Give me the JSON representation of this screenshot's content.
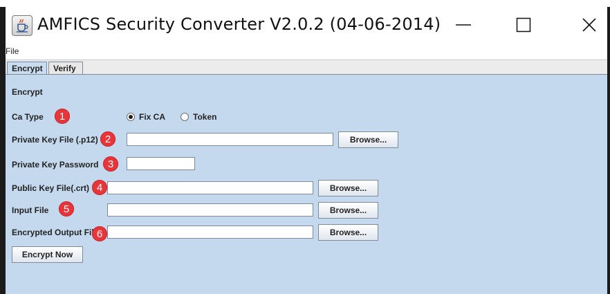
{
  "window": {
    "title": "AMFICS Security Converter V2.0.2 (04-06-2014)",
    "icon": "java-cup-icon"
  },
  "menu": {
    "file_label": "File"
  },
  "tabs": [
    {
      "label": "Encrypt",
      "active": true
    },
    {
      "label": "Verify",
      "active": false
    }
  ],
  "panel": {
    "section_label": "Encrypt",
    "ca_type": {
      "label": "Ca Type",
      "badge": "1",
      "options": [
        {
          "label": "Fix CA",
          "selected": true
        },
        {
          "label": "Token",
          "selected": false
        }
      ]
    },
    "private_key": {
      "label": "Private Key File (.p12)",
      "badge": "2",
      "value": "",
      "browse_label": "Browse..."
    },
    "private_key_password": {
      "label": "Private Key Password",
      "badge": "3",
      "value": ""
    },
    "public_key": {
      "label": "Public Key File(.crt)",
      "badge": "4",
      "value": "",
      "browse_label": "Browse..."
    },
    "input_file": {
      "label": "Input File",
      "badge": "5",
      "value": "",
      "browse_label": "Browse..."
    },
    "output_file": {
      "label": "Encrypted Output File",
      "badge": "6",
      "value": "",
      "browse_label": "Browse..."
    },
    "encrypt_button": "Encrypt Now"
  },
  "colors": {
    "panel_bg": "#c5d9ee",
    "badge": "#e8353a"
  }
}
